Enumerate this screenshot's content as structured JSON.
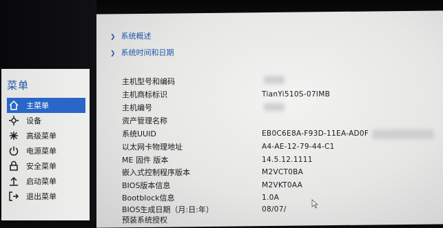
{
  "menu": {
    "title": "菜单",
    "items": [
      {
        "label": "主菜单",
        "icon": "home-icon"
      },
      {
        "label": "设备",
        "icon": "device-icon"
      },
      {
        "label": "高级菜单",
        "icon": "advanced-icon"
      },
      {
        "label": "电源菜单",
        "icon": "power-icon"
      },
      {
        "label": "安全菜单",
        "icon": "lock-icon"
      },
      {
        "label": "启动菜单",
        "icon": "boot-icon"
      },
      {
        "label": "退出菜单",
        "icon": "exit-icon"
      }
    ]
  },
  "nav": {
    "overview": "系统概述",
    "datetime": "系统时间和日期"
  },
  "info": [
    {
      "label": "主机型号和编码",
      "value": ""
    },
    {
      "label": "主机商标标识",
      "value": "TianYi510S-07IMB"
    },
    {
      "label": "主机编号",
      "value": ""
    },
    {
      "label": "资产管理名称",
      "value": ""
    },
    {
      "label": "系统UUID",
      "value": "EB0C6E8A-F93D-11EA-AD0F"
    },
    {
      "label": "以太网卡物理地址",
      "value": "A4-AE-12-79-44-C1"
    },
    {
      "label": "ME 固件 版本",
      "value": "14.5.12.1111"
    },
    {
      "label": "嵌入式控制程序版本",
      "value": "M2VCT0BA"
    },
    {
      "label": "BIOS版本信息",
      "value": "M2VKT0AA"
    },
    {
      "label": "Bootblock信息",
      "value": "1.0A"
    },
    {
      "label": "BIOS生成日期（月:日:年）",
      "value": "08/07/"
    },
    {
      "label": "预装系统授权",
      "value": ""
    }
  ],
  "colors": {
    "accent": "#2a66c7",
    "link": "#1f58a8"
  }
}
